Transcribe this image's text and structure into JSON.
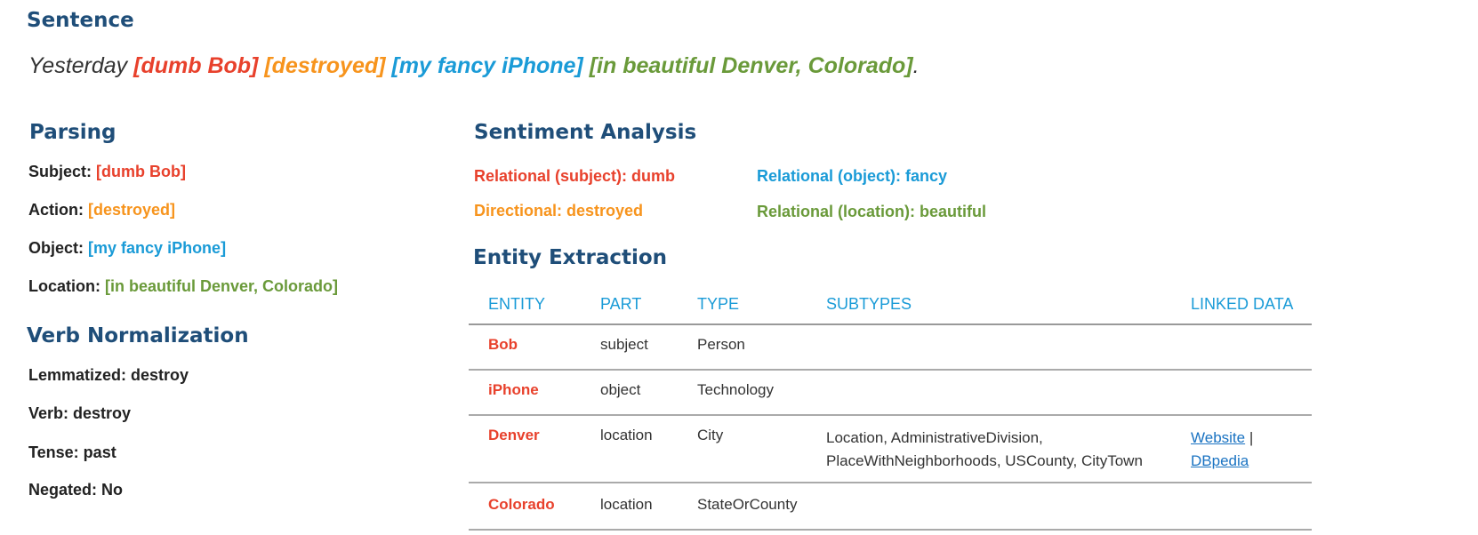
{
  "sentence": {
    "heading": "Sentence",
    "prefix": "Yesterday ",
    "subject": "[dumb Bob]",
    "action": "[destroyed]",
    "object": "[my fancy iPhone]",
    "location": "[in beautiful Denver, Colorado]",
    "suffix": "."
  },
  "parsing": {
    "heading": "Parsing",
    "subject_label": "Subject:",
    "subject_value": "[dumb Bob]",
    "action_label": "Action:",
    "action_value": "[destroyed]",
    "object_label": "Object:",
    "object_value": "[my fancy iPhone]",
    "location_label": "Location:",
    "location_value": "[in beautiful Denver, Colorado]"
  },
  "verb_normalization": {
    "heading": "Verb Normalization",
    "lemmatized": "Lemmatized: destroy",
    "verb": "Verb: destroy",
    "tense": "Tense: past",
    "negated": "Negated: No"
  },
  "sentiment": {
    "heading": "Sentiment Analysis",
    "relational_subject": "Relational (subject): dumb",
    "relational_object": "Relational (object): fancy",
    "directional": "Directional: destroyed",
    "relational_location": "Relational (location): beautiful"
  },
  "entity_extraction": {
    "heading": "Entity Extraction",
    "columns": [
      "ENTITY",
      "PART",
      "TYPE",
      "SUBTYPES",
      "LINKED DATA"
    ],
    "rows": [
      {
        "entity": "Bob",
        "part": "subject",
        "type": "Person",
        "subtypes_line1": "",
        "subtypes_line2": ""
      },
      {
        "entity": "iPhone",
        "part": "object",
        "type": "Technology",
        "subtypes_line1": "",
        "subtypes_line2": ""
      },
      {
        "entity": "Denver",
        "part": "location",
        "type": "City",
        "subtypes_line1": "Location, AdministrativeDivision,",
        "subtypes_line2": "PlaceWithNeighborhoods, USCounty, CityTown",
        "link1": "Website",
        "separator": " |",
        "link2": "DBpedia"
      },
      {
        "entity": "Colorado",
        "part": "location",
        "type": "StateOrCounty",
        "subtypes_line1": "",
        "subtypes_line2": ""
      }
    ]
  },
  "colors": {
    "heading": "#1f4e79",
    "subject": "#e8412c",
    "action": "#f7941d",
    "object": "#1a9bd7",
    "location": "#6a9a3a"
  }
}
